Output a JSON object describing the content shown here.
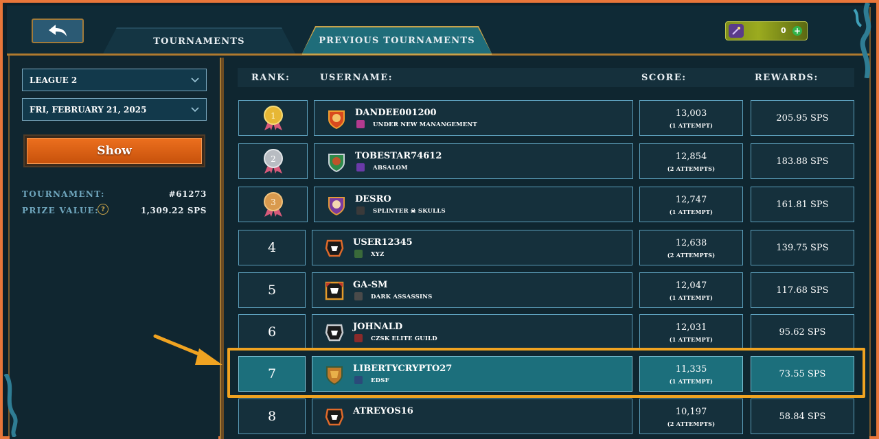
{
  "colors": {
    "accent_orange": "#e8763a",
    "highlight": "#f0a321",
    "show_button": "#ec6f1e",
    "row_bg": "#15303c",
    "row_highlight_bg": "#1c6f7c",
    "label_blue": "#6fa6bd"
  },
  "header": {
    "back_icon": "back-arrow-icon",
    "tabs": [
      {
        "label": "TOURNAMENTS",
        "active": false
      },
      {
        "label": "PREVIOUS TOURNAMENTS",
        "active": true
      }
    ],
    "wallet": {
      "icon": "wand-icon",
      "amount": "0",
      "add_icon": "plus-icon"
    }
  },
  "filters": {
    "league": "LEAGUE 2",
    "date": "FRI, FEBRUARY 21, 2025",
    "show_label": "Show"
  },
  "tournament_info": {
    "tournament_label": "TOURNAMENT:",
    "tournament_value": "#61273",
    "prize_label": "PRIZE VALUE:",
    "prize_value": "1,309.22 SPS",
    "help_icon": "?"
  },
  "table": {
    "headers": {
      "rank": "RANK:",
      "username": "USERNAME:",
      "score": "SCORE:",
      "rewards": "REWARDS:"
    },
    "rows": [
      {
        "rank": "1",
        "medal": "gold",
        "username": "DANDEE001200",
        "guild": "UNDER NEW MANANGEMENT",
        "score": "13,003",
        "attempts": "(1 ATTEMPT)",
        "reward": "205.95 SPS",
        "highlight": false
      },
      {
        "rank": "2",
        "medal": "silver",
        "username": "TOBESTAR74612",
        "guild": "ABSALOM",
        "score": "12,854",
        "attempts": "(2 ATTEMPTS)",
        "reward": "183.88 SPS",
        "highlight": false
      },
      {
        "rank": "3",
        "medal": "bronze",
        "username": "DESRO",
        "guild": "SPLINTER ☠ SKULLS",
        "score": "12,747",
        "attempts": "(1 ATTEMPT)",
        "reward": "161.81 SPS",
        "highlight": false
      },
      {
        "rank": "4",
        "medal": "",
        "username": "USER12345",
        "guild": "XYZ",
        "score": "12,638",
        "attempts": "(2 ATTEMPTS)",
        "reward": "139.75 SPS",
        "highlight": false
      },
      {
        "rank": "5",
        "medal": "",
        "username": "GA-SM",
        "guild": "DARK ASSASSINS",
        "score": "12,047",
        "attempts": "(1 ATTEMPT)",
        "reward": "117.68 SPS",
        "highlight": false
      },
      {
        "rank": "6",
        "medal": "",
        "username": "JOHNALD",
        "guild": "CZSK ELITE GUILD",
        "score": "12,031",
        "attempts": "(1 ATTEMPT)",
        "reward": "95.62 SPS",
        "highlight": false
      },
      {
        "rank": "7",
        "medal": "",
        "username": "LIBERTYCRYPTO27",
        "guild": "EDSF",
        "score": "11,335",
        "attempts": "(1 ATTEMPT)",
        "reward": "73.55 SPS",
        "highlight": true
      },
      {
        "rank": "8",
        "medal": "",
        "username": "ATREYOS16",
        "guild": "",
        "score": "10,197",
        "attempts": "(2 ATTEMPTS)",
        "reward": "58.84 SPS",
        "highlight": false
      }
    ]
  }
}
